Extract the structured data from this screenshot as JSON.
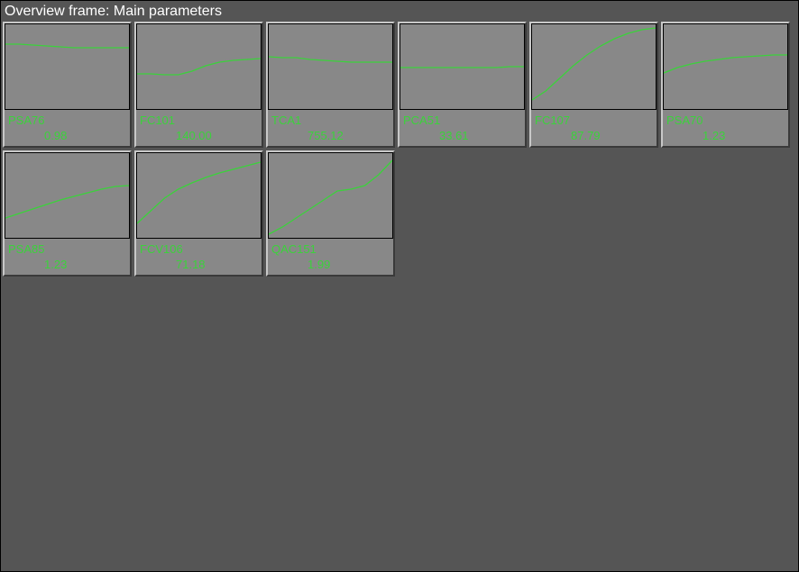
{
  "title": "Overview frame: Main parameters",
  "accent_color": "#3bd23b",
  "chart_data": [
    {
      "name": "PSA76",
      "value": "0.98",
      "type": "line",
      "points": [
        22,
        22,
        23,
        24,
        25,
        26,
        26,
        26,
        26,
        26
      ]
    },
    {
      "name": "FC101",
      "value": "140.00",
      "type": "line",
      "points": [
        55,
        55,
        56,
        56,
        52,
        46,
        42,
        40,
        39,
        38
      ]
    },
    {
      "name": "TCA1",
      "value": "755.12",
      "type": "line",
      "points": [
        36,
        37,
        37,
        39,
        40,
        41,
        42,
        42,
        42,
        42
      ]
    },
    {
      "name": "PCA51",
      "value": "33.61",
      "type": "line",
      "points": [
        48,
        48,
        48,
        48,
        48,
        48,
        48,
        48,
        47,
        47
      ]
    },
    {
      "name": "FC107",
      "value": "87.79",
      "type": "line",
      "points": [
        84,
        74,
        60,
        46,
        34,
        24,
        16,
        10,
        6,
        4
      ]
    },
    {
      "name": "PSA70",
      "value": "1.23",
      "type": "line",
      "points": [
        54,
        48,
        44,
        41,
        39,
        37,
        36,
        35,
        34,
        34
      ]
    },
    {
      "name": "PSA85",
      "value": "1.23",
      "type": "line",
      "points": [
        72,
        67,
        62,
        57,
        52,
        48,
        44,
        40,
        37,
        36
      ]
    },
    {
      "name": "FCV106",
      "value": "71.18",
      "type": "line",
      "points": [
        78,
        64,
        50,
        40,
        33,
        27,
        22,
        18,
        14,
        10
      ]
    },
    {
      "name": "QAC151",
      "value": "1.99",
      "type": "line",
      "points": [
        90,
        82,
        72,
        62,
        52,
        42,
        40,
        36,
        24,
        8
      ]
    }
  ]
}
